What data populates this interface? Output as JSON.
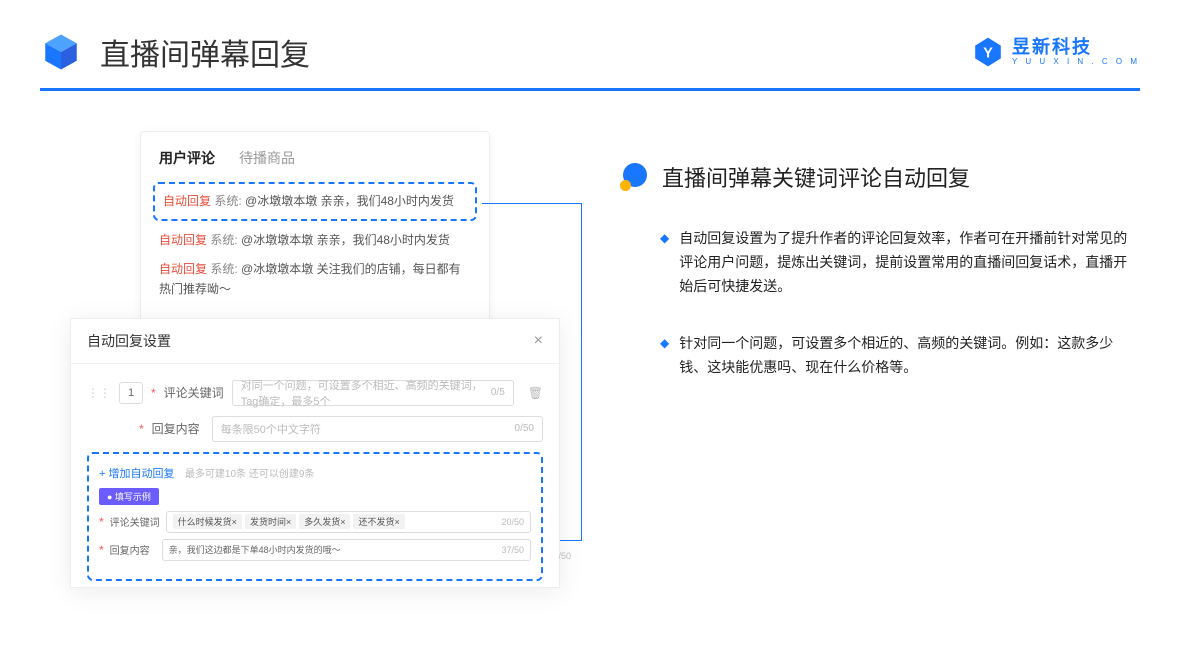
{
  "header": {
    "title": "直播间弹幕回复",
    "logo_text": "昱新科技",
    "logo_sub": "Y U U X I N . C O M"
  },
  "comments": {
    "tab_active": "用户评论",
    "tab_inactive": "待播商品",
    "highlighted": {
      "tag": "自动回复",
      "sys": "系统:",
      "text": "@冰墩墩本墩 亲亲，我们48小时内发货"
    },
    "lines": [
      {
        "tag": "自动回复",
        "sys": "系统:",
        "text": "@冰墩墩本墩 亲亲，我们48小时内发货"
      },
      {
        "tag": "自动回复",
        "sys": "系统:",
        "text": "@冰墩墩本墩 关注我们的店铺，每日都有热门推荐呦～"
      }
    ]
  },
  "settings": {
    "title": "自动回复设置",
    "close": "×",
    "row_number": "1",
    "keyword_label": "评论关键词",
    "keyword_placeholder": "对同一个问题，可设置多个相近、高频的关键词，Tag确定，最多5个",
    "keyword_counter": "0/5",
    "content_label": "回复内容",
    "content_placeholder": "每条限50个中文字符",
    "content_counter": "0/50",
    "add_link": "+ 增加自动回复",
    "add_note": "最多可建10条 还可以创建9条",
    "example_badge": "● 填写示例",
    "ex_keyword_label": "评论关键词",
    "ex_chips": [
      "什么时候发货×",
      "发货时间×",
      "多久发货×",
      "还不发货×"
    ],
    "ex_keyword_counter": "20/50",
    "ex_content_label": "回复内容",
    "ex_content_text": "亲，我们这边都是下单48小时内发货的哦～",
    "ex_content_counter": "37/50",
    "extra_counter": "/50"
  },
  "right": {
    "title": "直播间弹幕关键词评论自动回复",
    "bullets": [
      "自动回复设置为了提升作者的评论回复效率，作者可在开播前针对常见的评论用户问题，提炼出关键词，提前设置常用的直播间回复话术，直播开始后可快捷发送。",
      "针对同一个问题，可设置多个相近的、高频的关键词。例如：这款多少钱、这块能优惠吗、现在什么价格等。"
    ]
  }
}
